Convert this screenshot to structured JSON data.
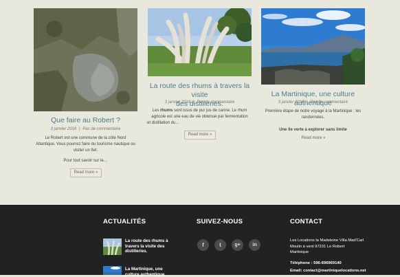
{
  "cards": [
    {
      "title": "Que faire au Robert ?",
      "date": "3 janvier 2016",
      "separator": "|",
      "comments": "Pas de commentaire",
      "excerpt_lines": [
        "Le Robert est une commune de la côte Nord",
        "Atlantique. Vous pourrez faire du tourisme nautique ou",
        "visiter un îlet."
      ],
      "extra_line": "Pour tout savoir sur le…",
      "read_more": "Read more »"
    },
    {
      "title_lines": [
        "La route des rhums à travers la visite",
        "des distilleries."
      ],
      "date": "3 janvier 2016",
      "separator": "|",
      "comments": "Pas de commentaire",
      "excerpt_bold": "rhums",
      "excerpt_pre": "Les ",
      "excerpt_post": " sont issus de pur jus de canne. Le rhum",
      "excerpt_lines": [
        "agricole est une eau de vie obtenue par fermentation",
        "et distillation du…"
      ],
      "read_more": "Read more »"
    },
    {
      "title": "La Martinique, une culture authentique",
      "date": "3 janvier 2016",
      "separator": "|",
      "comments": "Pas de commentaire",
      "excerpt_lines": [
        "Première étape de notre voyage à la Martinique : les",
        "randonnées."
      ],
      "extra_line": "Une île verte à explorer sans limite",
      "read_more": "Read more »"
    }
  ],
  "footer": {
    "news_title": "ACTUALITÉS",
    "social_title": "SUIVEZ-NOUS",
    "contact_title": "CONTACT",
    "news": [
      {
        "lines": [
          "La route des rhums à",
          "travers la visite des",
          "distilleries."
        ]
      },
      {
        "lines": [
          "La Martinique, une",
          "culture authentique"
        ]
      }
    ],
    "social": [
      {
        "icon": "facebook-icon",
        "glyph": "f"
      },
      {
        "icon": "twitter-icon",
        "glyph": "t"
      },
      {
        "icon": "google-plus-icon",
        "glyph": "g+"
      },
      {
        "icon": "linkedin-icon",
        "glyph": "in"
      }
    ],
    "contact": {
      "lines": [
        "Les Locations la Madeleine Villa Mad'Carl",
        "Moulin à vent 97231 Le Robert",
        "Martinique"
      ],
      "phone": "Téléphone : 596-696969140",
      "email": "Email: contact@martiniquelocations.net"
    }
  }
}
